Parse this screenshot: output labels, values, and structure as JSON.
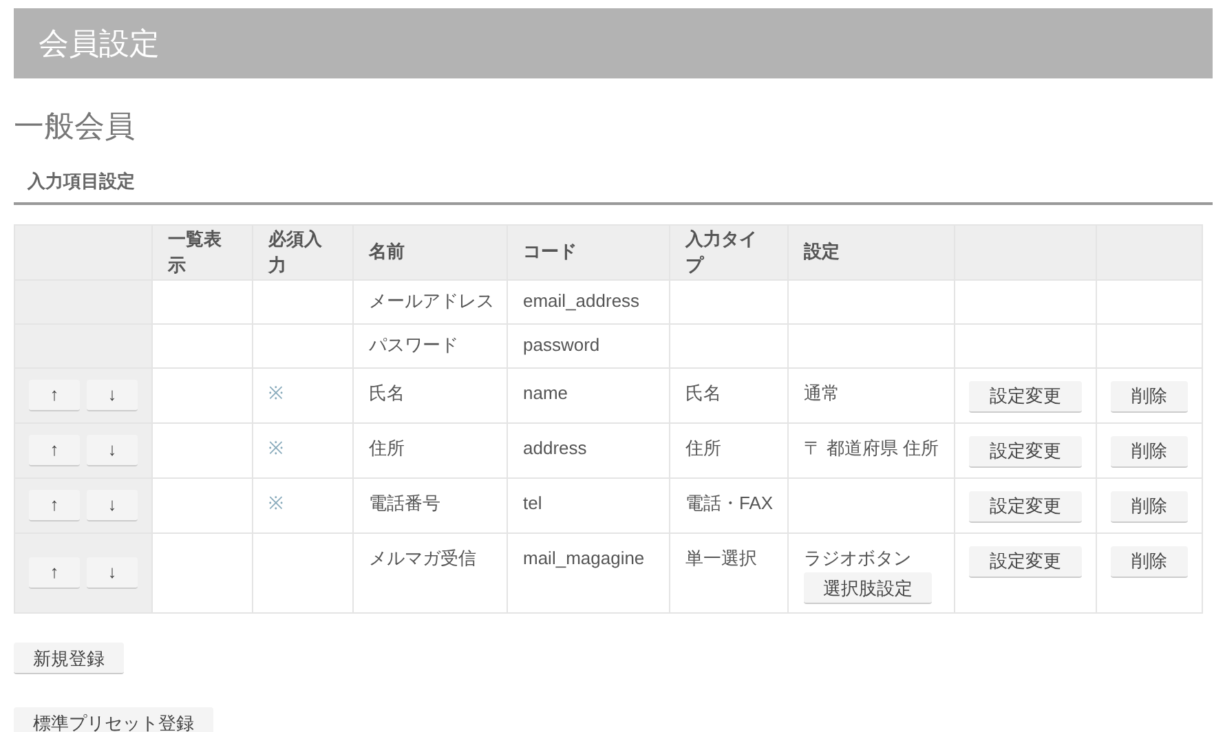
{
  "header": {
    "title": "会員設定"
  },
  "section_title": "一般会員",
  "subsection_title": "入力項目設定",
  "table": {
    "columns": [
      "",
      "一覧表示",
      "必須入力",
      "名前",
      "コード",
      "入力タイプ",
      "設定",
      "",
      ""
    ],
    "rows": [
      {
        "kind": "fixed",
        "required": "",
        "name": "メールアドレス",
        "code": "email_address",
        "type": "",
        "setting": ""
      },
      {
        "kind": "fixed",
        "required": "",
        "name": "パスワード",
        "code": "password",
        "type": "",
        "setting": ""
      },
      {
        "kind": "custom",
        "up": "↑",
        "down": "↓",
        "required": "※",
        "name": "氏名",
        "code": "name",
        "type": "氏名",
        "setting": "通常",
        "edit": "設定変更",
        "delete": "削除"
      },
      {
        "kind": "custom",
        "up": "↑",
        "down": "↓",
        "required": "※",
        "name": "住所",
        "code": "address",
        "type": "住所",
        "setting": "〒 都道府県 住所",
        "edit": "設定変更",
        "delete": "削除"
      },
      {
        "kind": "custom",
        "up": "↑",
        "down": "↓",
        "required": "※",
        "name": "電話番号",
        "code": "tel",
        "type": "電話・FAX",
        "setting": "",
        "edit": "設定変更",
        "delete": "削除"
      },
      {
        "kind": "custom",
        "up": "↑",
        "down": "↓",
        "required": "",
        "name": "メルマガ受信",
        "code": "mail_magagine",
        "type": "単一選択",
        "setting": "ラジオボタン",
        "setting_button": "選択肢設定",
        "edit": "設定変更",
        "delete": "削除"
      }
    ]
  },
  "buttons": [
    "新規登録",
    "標準プリセット登録"
  ]
}
